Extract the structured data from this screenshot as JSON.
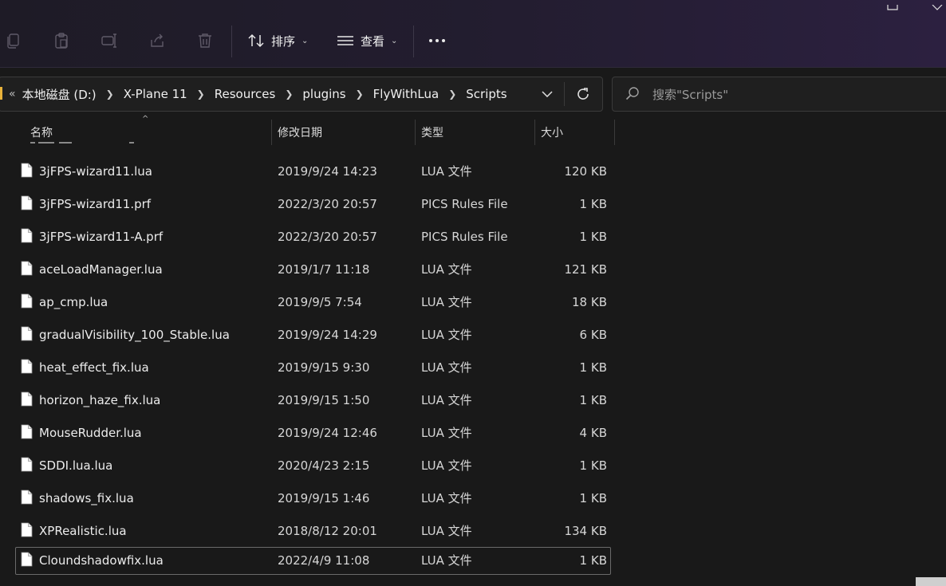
{
  "toolbar": {
    "sort_label": "排序",
    "view_label": "查看"
  },
  "address": {
    "crumbs": [
      "本地磁盘 (D:)",
      "X-Plane 11",
      "Resources",
      "plugins",
      "FlyWithLua",
      "Scripts"
    ]
  },
  "search": {
    "placeholder": "搜索\"Scripts\""
  },
  "columns": {
    "name": "名称",
    "date": "修改日期",
    "type": "类型",
    "size": "大小"
  },
  "files": [
    {
      "name": "3jFPS-wizard11.lua",
      "date": "2019/9/24 14:23",
      "type": "LUA 文件",
      "size": "120 KB"
    },
    {
      "name": "3jFPS-wizard11.prf",
      "date": "2022/3/20 20:57",
      "type": "PICS Rules File",
      "size": "1 KB"
    },
    {
      "name": "3jFPS-wizard11-A.prf",
      "date": "2022/3/20 20:57",
      "type": "PICS Rules File",
      "size": "1 KB"
    },
    {
      "name": "aceLoadManager.lua",
      "date": "2019/1/7 11:18",
      "type": "LUA 文件",
      "size": "121 KB"
    },
    {
      "name": "ap_cmp.lua",
      "date": "2019/9/5 7:54",
      "type": "LUA 文件",
      "size": "18 KB"
    },
    {
      "name": "gradualVisibility_100_Stable.lua",
      "date": "2019/9/24 14:29",
      "type": "LUA 文件",
      "size": "6 KB"
    },
    {
      "name": "heat_effect_fix.lua",
      "date": "2019/9/15 9:30",
      "type": "LUA 文件",
      "size": "1 KB"
    },
    {
      "name": "horizon_haze_fix.lua",
      "date": "2019/9/15 1:50",
      "type": "LUA 文件",
      "size": "1 KB"
    },
    {
      "name": "MouseRudder.lua",
      "date": "2019/9/24 12:46",
      "type": "LUA 文件",
      "size": "4 KB"
    },
    {
      "name": "SDDI.lua.lua",
      "date": "2020/4/23 2:15",
      "type": "LUA 文件",
      "size": "1 KB"
    },
    {
      "name": "shadows_fix.lua",
      "date": "2019/9/15 1:46",
      "type": "LUA 文件",
      "size": "1 KB"
    },
    {
      "name": "XPRealistic.lua",
      "date": "2018/8/12 20:01",
      "type": "LUA 文件",
      "size": "134 KB"
    },
    {
      "name": "Cloundshadowfix.lua",
      "date": "2022/4/9 11:08",
      "type": "LUA 文件",
      "size": "1 KB",
      "selected": true
    }
  ],
  "icons": {
    "copy": "copy-icon",
    "paste": "paste-icon",
    "rename": "rename-icon",
    "share": "share-icon",
    "delete": "delete-icon",
    "sort": "sort-icon",
    "view": "view-icon",
    "more": "more-icon",
    "refresh": "refresh-icon",
    "search": "search-icon",
    "file": "file-icon"
  },
  "colors": {
    "background": "#191919",
    "toolbar_accent": "#2c2040",
    "folder_flag": "#e8b23a"
  }
}
